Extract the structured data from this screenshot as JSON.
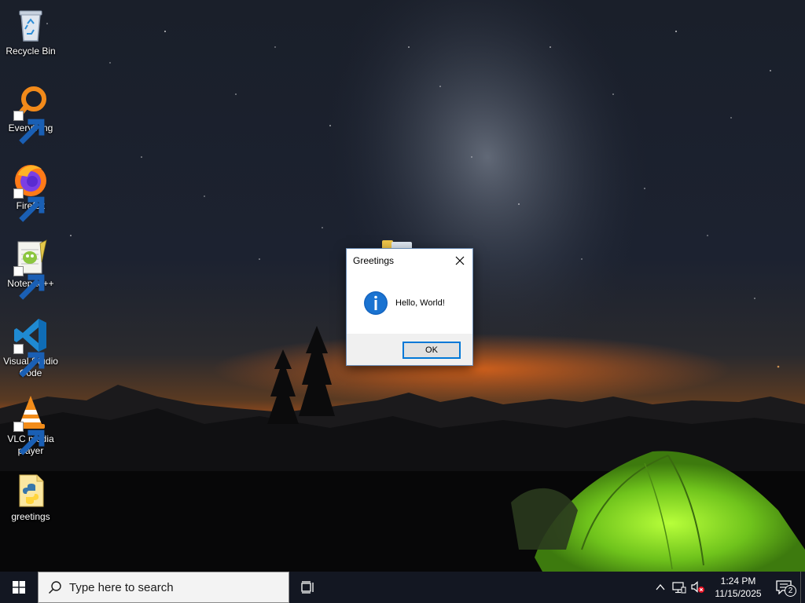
{
  "desktop": {
    "icons": [
      {
        "label": "Recycle Bin",
        "icon": "recycle-bin-icon"
      },
      {
        "label": "Everything",
        "icon": "everything-search-icon"
      },
      {
        "label": "Firefox",
        "icon": "firefox-icon"
      },
      {
        "label": "Notepad++",
        "icon": "notepad-plus-plus-icon"
      },
      {
        "label": "Visual Studio Code",
        "icon": "vscode-icon"
      },
      {
        "label": "VLC media player",
        "icon": "vlc-icon"
      },
      {
        "label": "greetings",
        "icon": "python-file-icon"
      }
    ]
  },
  "dialog": {
    "title": "Greetings",
    "message": "Hello, World!",
    "ok_label": "OK",
    "icon": "info-icon"
  },
  "taskbar": {
    "search_placeholder": "Type here to search",
    "clock_time": "1:24 PM",
    "clock_date": "11/15/2025",
    "notification_count": "2"
  },
  "colors": {
    "taskbar_bg": "#131722",
    "accent": "#0078d7",
    "tent_green": "#7fd321"
  }
}
